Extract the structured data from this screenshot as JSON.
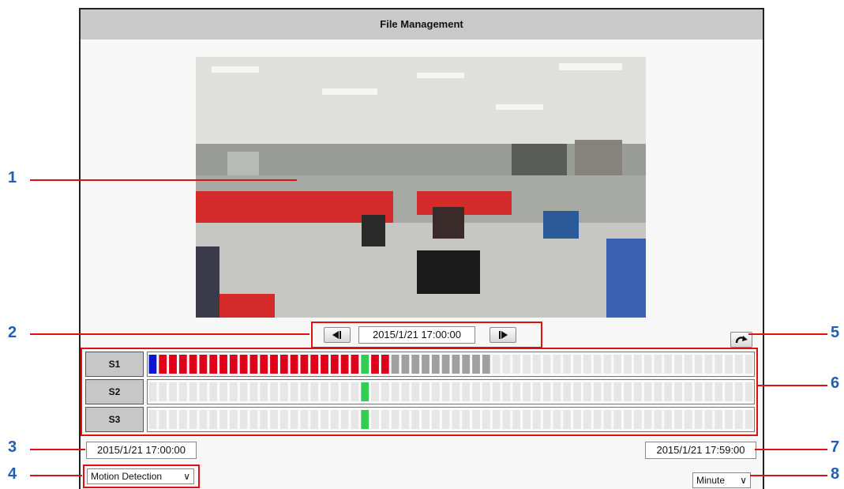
{
  "header": {
    "title": "File Management"
  },
  "player": {
    "current_time": "2015/1/21 17:00:00",
    "prev_label": "previous",
    "next_label": "next"
  },
  "tracks": [
    {
      "label": "S1"
    },
    {
      "label": "S2"
    },
    {
      "label": "S3"
    }
  ],
  "range": {
    "start": "2015/1/21 17:00:00",
    "end": "2015/1/21 17:59:00"
  },
  "filter": {
    "selected": "Motion Detection"
  },
  "scale": {
    "selected": "Minute"
  },
  "callouts": [
    "1",
    "2",
    "3",
    "4",
    "5",
    "6",
    "7",
    "8"
  ],
  "colors": {
    "blue": "#0a14d8",
    "red": "#e0001a",
    "green": "#33cc55",
    "gray": "#a0a0a0",
    "empty": "#e6e6e6",
    "accent_border": "#dd1111",
    "callout_text": "#1f5fb4"
  },
  "timeline": {
    "minutes": 60,
    "S1": [
      "blue",
      "red",
      "red",
      "red",
      "red",
      "red",
      "red",
      "red",
      "red",
      "red",
      "red",
      "red",
      "red",
      "red",
      "red",
      "red",
      "red",
      "red",
      "red",
      "red",
      "red",
      "green",
      "red",
      "red",
      "gray",
      "gray",
      "gray",
      "gray",
      "gray",
      "gray",
      "gray",
      "gray",
      "gray",
      "gray"
    ],
    "S2": [
      "empty",
      "empty",
      "empty",
      "empty",
      "empty",
      "empty",
      "empty",
      "empty",
      "empty",
      "empty",
      "empty",
      "empty",
      "empty",
      "empty",
      "empty",
      "empty",
      "empty",
      "empty",
      "empty",
      "empty",
      "empty",
      "green"
    ],
    "S3": [
      "empty",
      "empty",
      "empty",
      "empty",
      "empty",
      "empty",
      "empty",
      "empty",
      "empty",
      "empty",
      "empty",
      "empty",
      "empty",
      "empty",
      "empty",
      "empty",
      "empty",
      "empty",
      "empty",
      "empty",
      "empty",
      "green"
    ]
  }
}
